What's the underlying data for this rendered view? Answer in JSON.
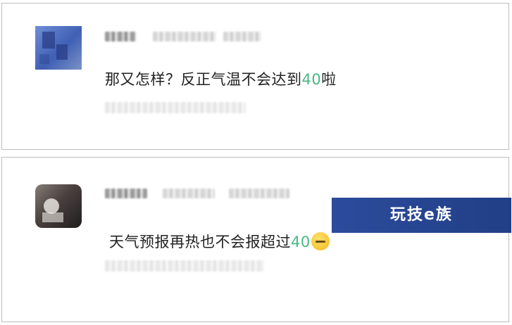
{
  "comments": [
    {
      "text_before": "那又怎样？反正气温不会达到",
      "number": "40",
      "text_after": "啦"
    },
    {
      "text_before": "天气预报再热也不会报超过",
      "number": "40",
      "emoji": "smirk-face-icon"
    }
  ],
  "watermark": {
    "text": "玩技e族"
  },
  "colors": {
    "number_accent": "#48b984",
    "watermark_bg": "#23438c"
  }
}
